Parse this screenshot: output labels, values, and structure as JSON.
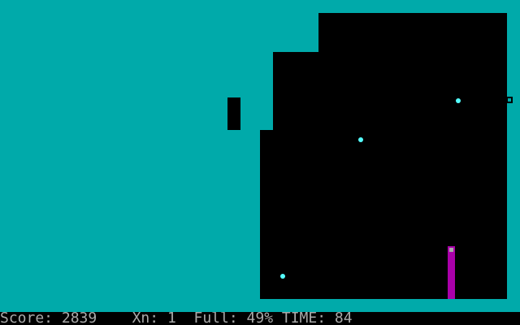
{
  "game": {
    "title": ""
  },
  "colors": {
    "filled": "#00aaaa",
    "unfilled": "#000000",
    "ball": "#55ffff",
    "trail": "#aa00aa",
    "cursor_fill": "#aaaaaa",
    "text": "#aaaaaa"
  },
  "status": {
    "score_label": "Score:",
    "score_value": "2839",
    "lives_label": "Xn:",
    "lives_value": "1",
    "full_label": "Full:",
    "full_value": "49%",
    "time_label": "TIME:",
    "time_value": "84"
  },
  "state": {
    "fill_percent": 49,
    "balls_in_void": 3,
    "enemies_on_border": 1
  }
}
